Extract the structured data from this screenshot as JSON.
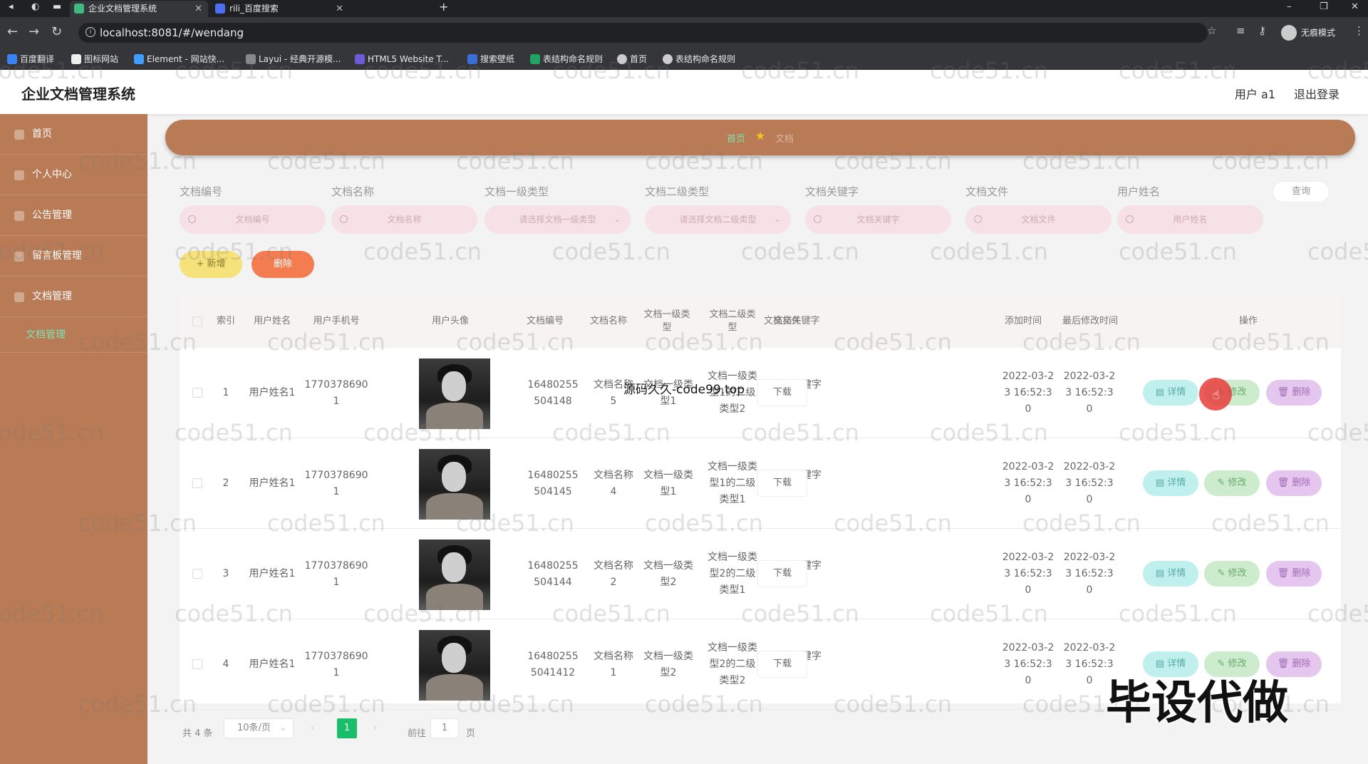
{
  "browser": {
    "tabs": [
      {
        "title": "企业文档管理系统",
        "active": true
      },
      {
        "title": "rili_百度搜索",
        "active": false
      }
    ],
    "new_tab": "+",
    "url": "localhost:8081/#/wendang",
    "profile": "无痕模式",
    "bookmarks": [
      "百度翻译",
      "图标网站",
      "Element - 网站快...",
      "Layui - 经典开源模...",
      "HTML5 Website T...",
      "搜索壁纸",
      "表结构命名规则",
      "首页",
      "表结构命名规则"
    ]
  },
  "header": {
    "title": "企业文档管理系统",
    "user": "用户 a1",
    "logout": "退出登录"
  },
  "sidebar": {
    "items": [
      {
        "label": "首页"
      },
      {
        "label": "个人中心"
      },
      {
        "label": "公告管理"
      },
      {
        "label": "留言板管理"
      },
      {
        "label": "文档管理"
      }
    ],
    "sub_item": "文档管理"
  },
  "breadcrumb": {
    "home": "首页",
    "current": "文档"
  },
  "filters": [
    {
      "label": "文档编号",
      "placeholder": "文档编号"
    },
    {
      "label": "文档名称",
      "placeholder": "文档名称"
    },
    {
      "label": "文档一级类型",
      "placeholder": "请选择文档一级类型"
    },
    {
      "label": "文档二级类型",
      "placeholder": "请选择文档二级类型"
    },
    {
      "label": "文档关键字",
      "placeholder": "文档关键字"
    },
    {
      "label": "文档文件",
      "placeholder": "文档文件"
    },
    {
      "label": "用户姓名",
      "placeholder": "用户姓名"
    }
  ],
  "actions": {
    "query": "查询",
    "add": "+ 新增",
    "delete": "删除"
  },
  "table": {
    "headers": [
      "索引",
      "用户姓名",
      "用户手机号",
      "用户头像",
      "文档编号",
      "文档名称",
      "文档一级类型",
      "文档二级类型",
      "文档关键字",
      "文档文件",
      "添加时间",
      "最后修改时间",
      "操作"
    ],
    "rows": [
      {
        "index": "1",
        "user": "用户姓名1",
        "phone": "17703786901",
        "doc_no": "16480255504148",
        "doc_name": "文档名称5",
        "type1": "文档一级类型1",
        "type2": "文档一级类型1的二级类型2",
        "keyword": "文档关键字5",
        "add_time": "2022-03-23 16:52:30",
        "mod_time": "2022-03-23 16:52:30"
      },
      {
        "index": "2",
        "user": "用户姓名1",
        "phone": "17703786901",
        "doc_no": "16480255504145",
        "doc_name": "文档名称4",
        "type1": "文档一级类型1",
        "type2": "文档一级类型1的二级类型1",
        "keyword": "文档关键字4",
        "add_time": "2022-03-23 16:52:30",
        "mod_time": "2022-03-23 16:52:30"
      },
      {
        "index": "3",
        "user": "用户姓名1",
        "phone": "17703786901",
        "doc_no": "16480255504144",
        "doc_name": "文档名称2",
        "type1": "文档一级类型2",
        "type2": "文档一级类型2的二级类型1",
        "keyword": "文档关键字2",
        "add_time": "2022-03-23 16:52:30",
        "mod_time": "2022-03-23 16:52:30"
      },
      {
        "index": "4",
        "user": "用户姓名1",
        "phone": "17703786901",
        "doc_no": "164802555041412",
        "doc_name": "文档名称1",
        "type1": "文档一级类型2",
        "type2": "文档一级类型2的二级类型2",
        "keyword": "文档关键字1",
        "add_time": "2022-03-23 16:52:30",
        "mod_time": "2022-03-23 16:52:30"
      }
    ],
    "download_label": "下载",
    "op_labels": {
      "detail": "详情",
      "edit": "修改",
      "delete": "删除"
    }
  },
  "pagination": {
    "total": "共 4 条",
    "page_size": "10条/页",
    "current_page": "1",
    "goto_label": "前往",
    "goto_value": "1",
    "page_suffix": "页"
  },
  "overlays": {
    "watermark": "code51.cn",
    "source": "源码久久-code99.top",
    "corner": "毕设代做"
  },
  "colors": {
    "sidebar": "#b97b55",
    "active_menu": "#7fe2b0",
    "page_active": "#19be6b"
  }
}
